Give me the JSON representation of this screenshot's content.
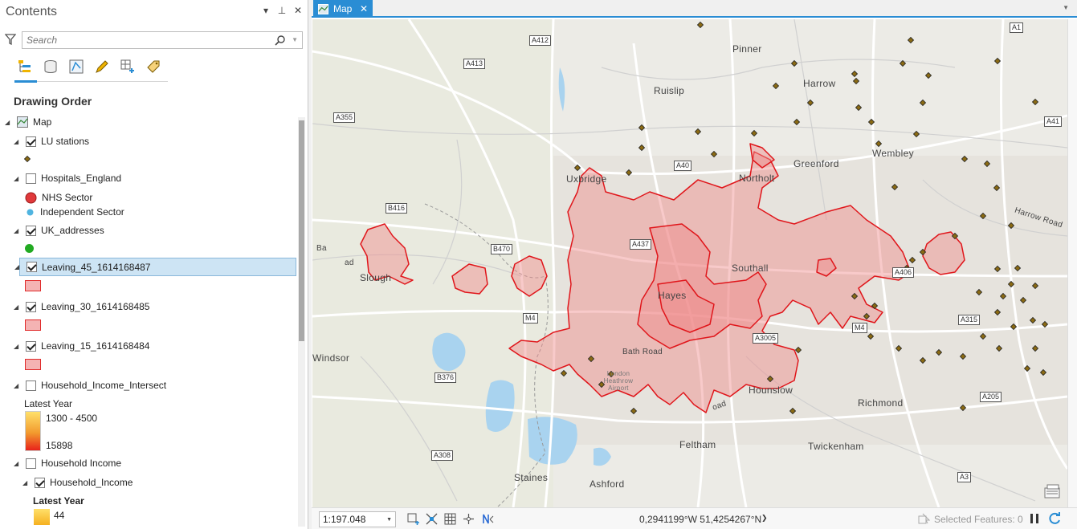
{
  "contents": {
    "title": "Contents",
    "controls": [
      "▾",
      "⊥",
      "✕"
    ],
    "search_placeholder": "Search",
    "drawing_order_label": "Drawing Order",
    "tree": {
      "map_label": "Map",
      "lu_stations": "LU stations",
      "hospitals": "Hospitals_England",
      "nhs_sector": "NHS Sector",
      "independent_sector": "Independent Sector",
      "uk_addresses": "UK_addresses",
      "leaving_45": "Leaving_45_1614168487",
      "leaving_30": "Leaving_30_1614168485",
      "leaving_15": "Leaving_15_1614168484",
      "household_intersect": "Household_Income_Intersect",
      "latest_year_1": "Latest Year",
      "range_high": "1300 - 4500",
      "range_low": "15898",
      "household_income_group": "Household Income",
      "household_income_layer": "Household_Income",
      "latest_year_2": "Latest Year",
      "value_44": "44"
    }
  },
  "map": {
    "tab_label": "Map",
    "labels": {
      "pinner": "Pinner",
      "harrow": "Harrow",
      "ruislip": "Ruislip",
      "wembley": "Wembley",
      "greenford": "Greenford",
      "northolt": "Northolt",
      "uxbridge": "Uxbridge",
      "southall": "Southall",
      "slough": "Slough",
      "hayes": "Hayes",
      "bath_road": "Bath Road",
      "windsor": "Windsor",
      "hounslow": "Hounslow",
      "richmond": "Richmond",
      "feltham": "Feltham",
      "twickenham": "Twickenham",
      "staines": "Staines",
      "ashford": "Ashford",
      "heathrow": "London Heathrow Airport",
      "harrow_road": "Harrow Road",
      "oad": "oad",
      "ba": "Ba",
      "ad": "ad"
    },
    "roads": {
      "a412": "A412",
      "a413": "A413",
      "a355": "A355",
      "a40": "A40",
      "b416": "B416",
      "b470": "B470",
      "a437": "A437",
      "m4_a": "M4",
      "m4_b": "M4",
      "a3005": "A3005",
      "b376": "B376",
      "a308": "A308",
      "a406": "A406",
      "a315": "A315",
      "a205": "A205",
      "a3": "A3",
      "a1": "A1",
      "a41": "A41"
    }
  },
  "status": {
    "scale": "1:197.048",
    "coordinates": "0,2941199°W 51,4254267°N",
    "selected_features": "Selected Features: 0"
  },
  "colors": {
    "accent": "#2a8dd4",
    "isochrone_fill": "#f08a8a",
    "isochrone_stroke": "#e0161b",
    "station_fill": "#8a6a14"
  }
}
